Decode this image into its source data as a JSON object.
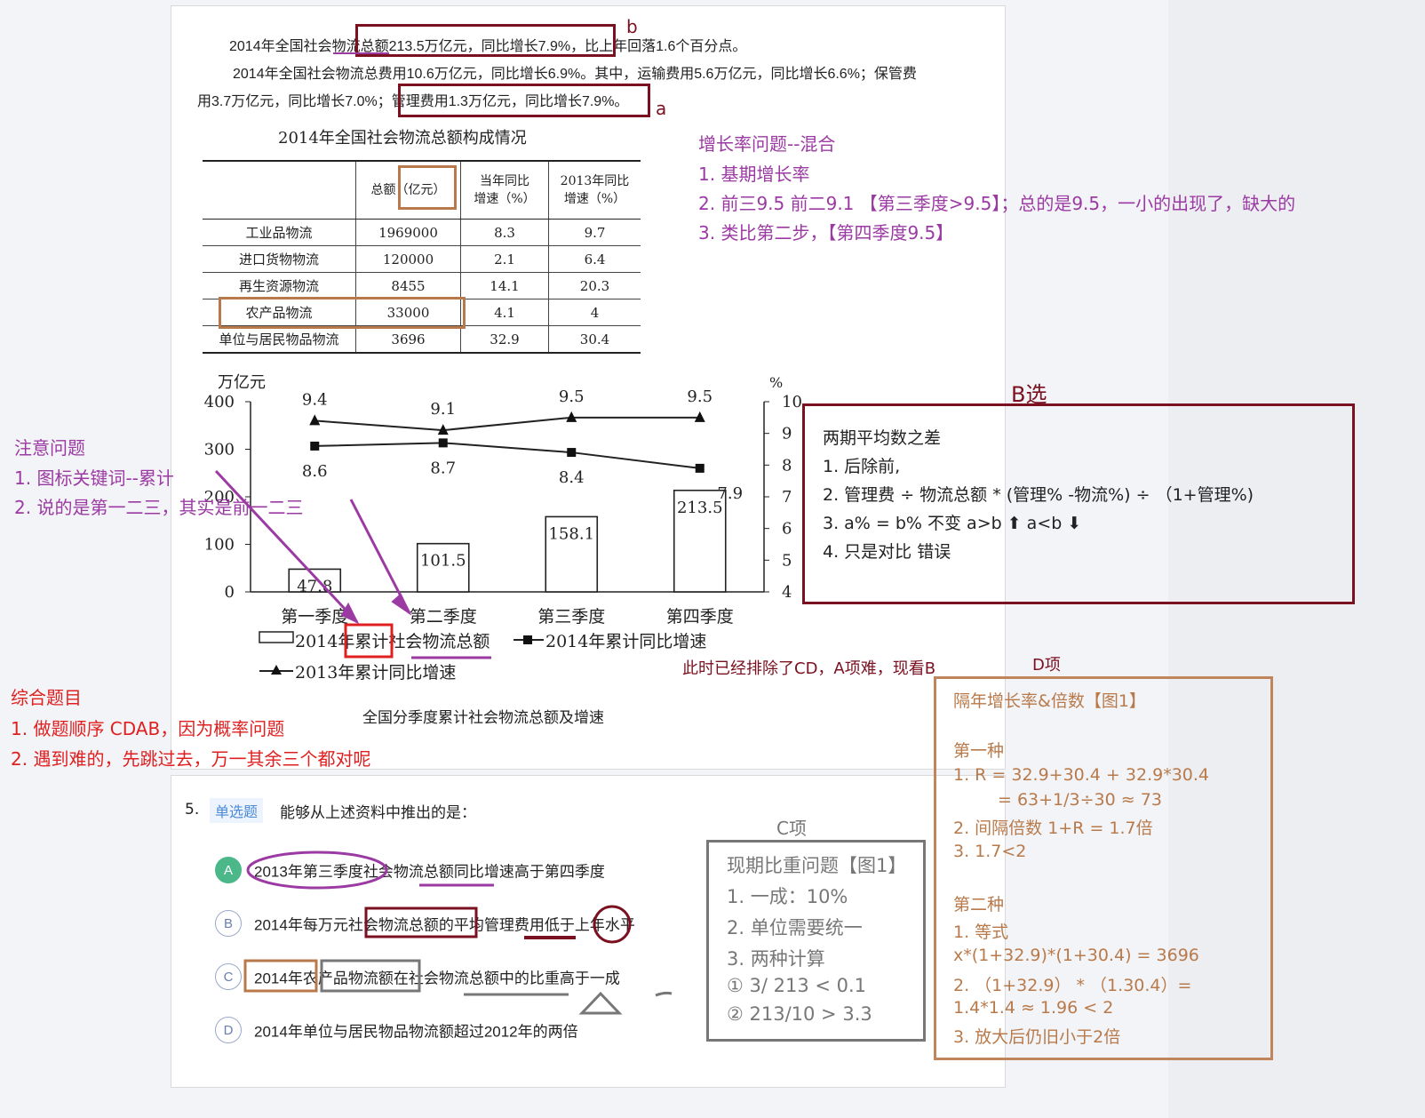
{
  "doc": {
    "p1": "2014年全国社会物流总额213.5万亿元，同比增长7.9%，比上年回落1.6个百分点。",
    "p2": "2014年全国社会物流总费用10.6万亿元，同比增长6.9%。其中，运输费用5.6万亿元，同比增长6.6%；保管费",
    "p3": "用3.7万亿元，同比增长7.0%；管理费用1.3万亿元，同比增长7.9%。",
    "table_title": "2014年全国社会物流总额构成情况",
    "table_headers": [
      "",
      "总额（亿元）",
      "当年同比\n增速（%）",
      "2013年同比\n增速（%）"
    ],
    "rows": [
      [
        "工业品物流",
        "1969000",
        "8.3",
        "9.7"
      ],
      [
        "进口货物物流",
        "120000",
        "2.1",
        "6.4"
      ],
      [
        "再生资源物流",
        "8455",
        "14.1",
        "20.3"
      ],
      [
        "农产品物流",
        "33000",
        "4.1",
        "4"
      ],
      [
        "单位与居民物品物流",
        "3696",
        "32.9",
        "30.4"
      ]
    ],
    "chart_caption": "全国分季度累计社会物流总额及增速"
  },
  "chart_data": {
    "type": "bar",
    "title": "全国分季度累计社会物流总额及增速",
    "categories": [
      "第一季度",
      "第二季度",
      "第三季度",
      "第四季度"
    ],
    "ylabel_left": "万亿元",
    "ylabel_right": "%",
    "ylim_left": [
      0,
      400
    ],
    "yticks_left": [
      0,
      100,
      200,
      300,
      400
    ],
    "ylim_right": [
      4,
      10
    ],
    "yticks_right": [
      4,
      5,
      6,
      7,
      8,
      9,
      10
    ],
    "series": [
      {
        "name": "2014年累计社会物流总额",
        "type": "bar",
        "axis": "left",
        "values": [
          47.8,
          101.5,
          158.1,
          213.5
        ]
      },
      {
        "name": "2014年累计同比增速",
        "type": "line",
        "marker": "square",
        "axis": "right",
        "values": [
          8.6,
          8.7,
          8.4,
          7.9
        ]
      },
      {
        "name": "2013年累计同比增速",
        "type": "line",
        "marker": "triangle",
        "axis": "right",
        "values": [
          9.4,
          9.1,
          9.5,
          9.5
        ]
      }
    ],
    "legend": [
      "2014年累计社会物流总额",
      "2014年累计同比增速",
      "2013年累计同比增速"
    ],
    "legend_position": "bottom"
  },
  "question": {
    "number": "5.",
    "type_tag": "单选题",
    "stem": "能够从上述资料中推出的是：",
    "options": [
      {
        "letter": "A",
        "text": "2013年第三季度社会物流总额同比增速高于第四季度",
        "selected": true
      },
      {
        "letter": "B",
        "text": "2014年每万元社会物流总额的平均管理费用低于上年水平",
        "selected": false
      },
      {
        "letter": "C",
        "text": "2014年农产品物流额在社会物流总额中的比重高于一成",
        "selected": false
      },
      {
        "letter": "D",
        "text": "2014年单位与居民物品物流额超过2012年的两倍",
        "selected": false
      }
    ]
  },
  "notes": {
    "mark_b": "b",
    "mark_a": "a",
    "growth": {
      "title": "增长率问题--混合",
      "l1": "1. 基期增长率",
      "l2": "2. 前三9.5 前二9.1 【第三季度>9.5】；总的是9.5，一小的出现了，缺大的",
      "l3": "3. 类比第二步，【第四季度9.5】"
    },
    "attention": {
      "title": "注意问题",
      "l1": "1. 图标关键词--累计",
      "l2": "2. 说的是第一二三，其实是前一二三"
    },
    "b_choice": {
      "title": "B选",
      "l0": "两期平均数之差",
      "l1": "1. 后除前,",
      "l2": "2. 管理费 ÷ 物流总额 * (管理% -物流%) ÷ （1+管理%)",
      "l3": "3. a% = b% 不变 a>b ⬆ a<b ⬇",
      "l4": "4. 只是对比 错误"
    },
    "excluded": "此时已经排除了CD，A项难，现看B",
    "d_item": {
      "title": "D项",
      "l0": "隔年增长率&倍数【图1】",
      "m1": "第一种",
      "m1a": "1. R = 32.9+30.4 + 32.9*30.4",
      "m1b": "= 63+1/3÷30 ≈ 73",
      "m1c": "2. 间隔倍数 1+R = 1.7倍",
      "m1d": "3. 1.7<2",
      "m2": "第二种",
      "m2a": "1. 等式",
      "m2b": "x*(1+32.9)*(1+30.4) = 3696",
      "m2c": "2. （1+32.9） * （1.30.4）=",
      "m2d": "1.4*1.4 ≈ 1.96 < 2",
      "m2e": "3. 放大后仍旧小于2倍"
    },
    "comprehensive": {
      "title": "综合题目",
      "l1": "1. 做题顺序 CDAB，因为概率问题",
      "l2": "2. 遇到难的，先跳过去，万一其余三个都对呢"
    },
    "c_item": {
      "title": "C项",
      "l0": "现期比重问题【图1】",
      "l1": "1. 一成：10%",
      "l2": "2. 单位需要统一",
      "l3": "3. 两种计算",
      "l4": "① 3/ 213 < 0.1",
      "l5": "② 213/10 > 3.3"
    }
  },
  "colors": {
    "purple": "#9b3aa3",
    "red": "#e02020",
    "maroon": "#7a1020",
    "brown": "#b87a4b",
    "gray": "#777777",
    "correct": "#4cb88a"
  }
}
